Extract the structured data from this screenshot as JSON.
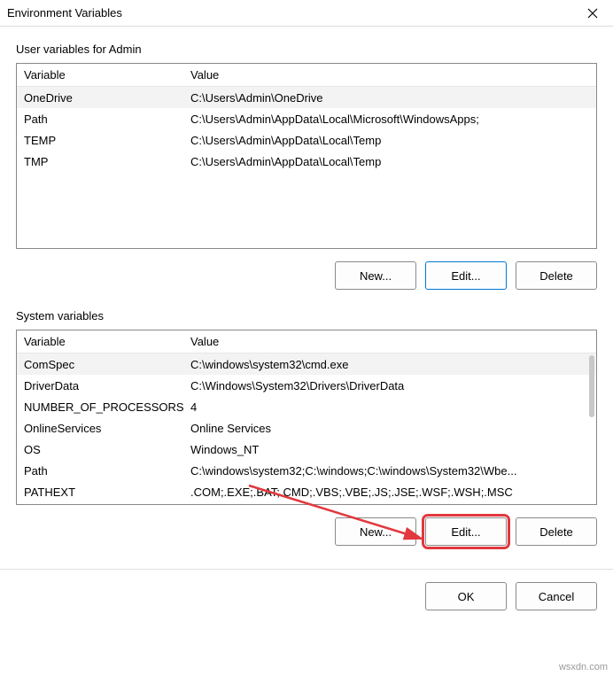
{
  "dialog": {
    "title": "Environment Variables"
  },
  "user_section": {
    "label": "User variables for Admin",
    "header": {
      "variable": "Variable",
      "value": "Value"
    },
    "rows": [
      {
        "var": "OneDrive",
        "val": "C:\\Users\\Admin\\OneDrive",
        "selected": true
      },
      {
        "var": "Path",
        "val": "C:\\Users\\Admin\\AppData\\Local\\Microsoft\\WindowsApps;"
      },
      {
        "var": "TEMP",
        "val": "C:\\Users\\Admin\\AppData\\Local\\Temp"
      },
      {
        "var": "TMP",
        "val": "C:\\Users\\Admin\\AppData\\Local\\Temp"
      }
    ],
    "buttons": {
      "new": "New...",
      "edit": "Edit...",
      "delete": "Delete"
    }
  },
  "system_section": {
    "label": "System variables",
    "header": {
      "variable": "Variable",
      "value": "Value"
    },
    "rows": [
      {
        "var": "ComSpec",
        "val": "C:\\windows\\system32\\cmd.exe",
        "selected": true
      },
      {
        "var": "DriverData",
        "val": "C:\\Windows\\System32\\Drivers\\DriverData"
      },
      {
        "var": "NUMBER_OF_PROCESSORS",
        "val": "4"
      },
      {
        "var": "OnlineServices",
        "val": "Online Services"
      },
      {
        "var": "OS",
        "val": "Windows_NT"
      },
      {
        "var": "Path",
        "val": "C:\\windows\\system32;C:\\windows;C:\\windows\\System32\\Wbe..."
      },
      {
        "var": "PATHEXT",
        "val": ".COM;.EXE;.BAT;.CMD;.VBS;.VBE;.JS;.JSE;.WSF;.WSH;.MSC"
      }
    ],
    "buttons": {
      "new": "New...",
      "edit": "Edit...",
      "delete": "Delete"
    }
  },
  "footer": {
    "ok": "OK",
    "cancel": "Cancel"
  },
  "watermark": "wsxdn.com"
}
